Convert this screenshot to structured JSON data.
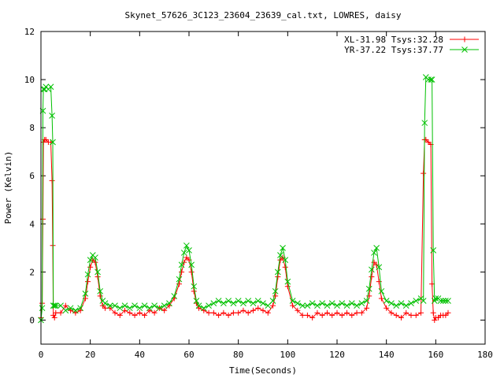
{
  "chart_data": {
    "type": "line",
    "title": "Skynet_57626_3C123_23604_23639_cal.txt, LOWRES, daisy",
    "xlabel": "Time(Seconds)",
    "ylabel": "Power (Kelvin)",
    "xlim": [
      0,
      180
    ],
    "ylim": [
      -1,
      12
    ],
    "xticks": [
      0,
      20,
      40,
      60,
      80,
      100,
      120,
      140,
      160,
      180
    ],
    "yticks": [
      0,
      2,
      4,
      6,
      8,
      10,
      12
    ],
    "grid": false,
    "legend_position": "top-right",
    "series": [
      {
        "name": "XL-31.98 Tsys:32.28",
        "color": "#ff0000",
        "marker": "plus",
        "x": [
          0.0,
          0.5,
          0.8,
          1.0,
          1.5,
          2.0,
          3.0,
          4.0,
          4.5,
          4.8,
          5.0,
          5.5,
          6,
          8,
          10,
          12,
          14,
          16,
          18,
          19,
          20,
          21,
          22,
          23,
          24,
          25,
          26,
          28,
          30,
          32,
          34,
          36,
          38,
          40,
          42,
          44,
          46,
          48,
          50,
          52,
          54,
          56,
          57,
          58,
          59,
          60,
          61,
          62,
          63,
          64,
          66,
          68,
          70,
          72,
          74,
          76,
          78,
          80,
          82,
          84,
          86,
          88,
          90,
          92,
          94,
          95,
          96,
          97,
          98,
          99,
          100,
          102,
          104,
          106,
          108,
          110,
          112,
          114,
          116,
          118,
          120,
          122,
          124,
          126,
          128,
          130,
          132,
          133,
          134,
          135,
          136,
          137,
          138,
          140,
          142,
          144,
          146,
          148,
          150,
          152,
          154,
          155,
          155.5,
          156,
          157,
          158,
          158.5,
          159,
          159.5,
          160,
          161,
          162,
          163,
          164,
          165
        ],
        "y": [
          0.1,
          0.7,
          4.2,
          7.4,
          7.5,
          7.5,
          7.4,
          7.4,
          5.8,
          3.1,
          0.2,
          0.1,
          0.3,
          0.3,
          0.6,
          0.4,
          0.3,
          0.4,
          0.9,
          1.6,
          2.2,
          2.5,
          2.4,
          1.8,
          1.0,
          0.6,
          0.5,
          0.5,
          0.3,
          0.2,
          0.4,
          0.3,
          0.2,
          0.3,
          0.2,
          0.4,
          0.3,
          0.5,
          0.4,
          0.6,
          0.9,
          1.5,
          2.0,
          2.4,
          2.6,
          2.5,
          2.0,
          1.2,
          0.7,
          0.5,
          0.4,
          0.3,
          0.3,
          0.2,
          0.3,
          0.2,
          0.3,
          0.3,
          0.4,
          0.3,
          0.4,
          0.5,
          0.4,
          0.3,
          0.6,
          1.0,
          1.8,
          2.5,
          2.6,
          2.2,
          1.4,
          0.6,
          0.4,
          0.2,
          0.2,
          0.1,
          0.3,
          0.2,
          0.3,
          0.2,
          0.3,
          0.2,
          0.3,
          0.2,
          0.3,
          0.3,
          0.5,
          1.0,
          1.8,
          2.4,
          2.3,
          1.6,
          0.9,
          0.5,
          0.3,
          0.2,
          0.1,
          0.3,
          0.2,
          0.2,
          0.3,
          6.1,
          7.5,
          7.5,
          7.4,
          7.3,
          1.5,
          0.3,
          0.0,
          0.1,
          0.1,
          0.2,
          0.2,
          0.2,
          0.3
        ]
      },
      {
        "name": "YR-37.22 Tsys:37.77",
        "color": "#00c000",
        "marker": "x",
        "x": [
          0.0,
          0.5,
          0.8,
          1.0,
          1.5,
          2.0,
          3.0,
          4.0,
          4.5,
          4.8,
          5.0,
          5.5,
          6,
          8,
          10,
          12,
          14,
          16,
          18,
          19,
          20,
          21,
          22,
          23,
          24,
          25,
          26,
          28,
          30,
          32,
          34,
          36,
          38,
          40,
          42,
          44,
          46,
          48,
          50,
          52,
          54,
          56,
          57,
          58,
          59,
          60,
          61,
          62,
          63,
          64,
          66,
          68,
          70,
          72,
          74,
          76,
          78,
          80,
          82,
          84,
          86,
          88,
          90,
          92,
          94,
          95,
          96,
          97,
          98,
          99,
          100,
          102,
          104,
          106,
          108,
          110,
          112,
          114,
          116,
          118,
          120,
          122,
          124,
          126,
          128,
          130,
          132,
          133,
          134,
          135,
          136,
          137,
          138,
          140,
          142,
          144,
          146,
          148,
          150,
          152,
          154,
          155,
          155.5,
          156,
          157,
          158,
          158.5,
          159,
          159.5,
          160,
          161,
          162,
          163,
          164,
          165
        ],
        "y": [
          0.0,
          0.5,
          8.7,
          9.6,
          9.6,
          9.7,
          9.6,
          9.7,
          8.5,
          7.4,
          0.6,
          0.6,
          0.6,
          0.6,
          0.4,
          0.5,
          0.4,
          0.5,
          1.1,
          1.9,
          2.5,
          2.7,
          2.6,
          2.0,
          1.2,
          0.8,
          0.7,
          0.6,
          0.6,
          0.5,
          0.6,
          0.5,
          0.6,
          0.5,
          0.6,
          0.5,
          0.6,
          0.5,
          0.6,
          0.7,
          1.0,
          1.7,
          2.3,
          2.8,
          3.1,
          2.9,
          2.3,
          1.4,
          0.8,
          0.6,
          0.5,
          0.6,
          0.7,
          0.8,
          0.7,
          0.8,
          0.7,
          0.8,
          0.7,
          0.8,
          0.7,
          0.8,
          0.7,
          0.6,
          0.8,
          1.2,
          2.0,
          2.7,
          3.0,
          2.5,
          1.6,
          0.8,
          0.7,
          0.6,
          0.6,
          0.7,
          0.6,
          0.7,
          0.6,
          0.7,
          0.6,
          0.7,
          0.6,
          0.7,
          0.6,
          0.7,
          0.8,
          1.3,
          2.1,
          2.8,
          3.0,
          2.2,
          1.2,
          0.8,
          0.7,
          0.6,
          0.7,
          0.6,
          0.7,
          0.8,
          0.9,
          0.8,
          8.2,
          10.1,
          10.0,
          10.0,
          10.0,
          2.9,
          0.8,
          0.9,
          0.9,
          0.8,
          0.8,
          0.8,
          0.8
        ]
      }
    ]
  }
}
